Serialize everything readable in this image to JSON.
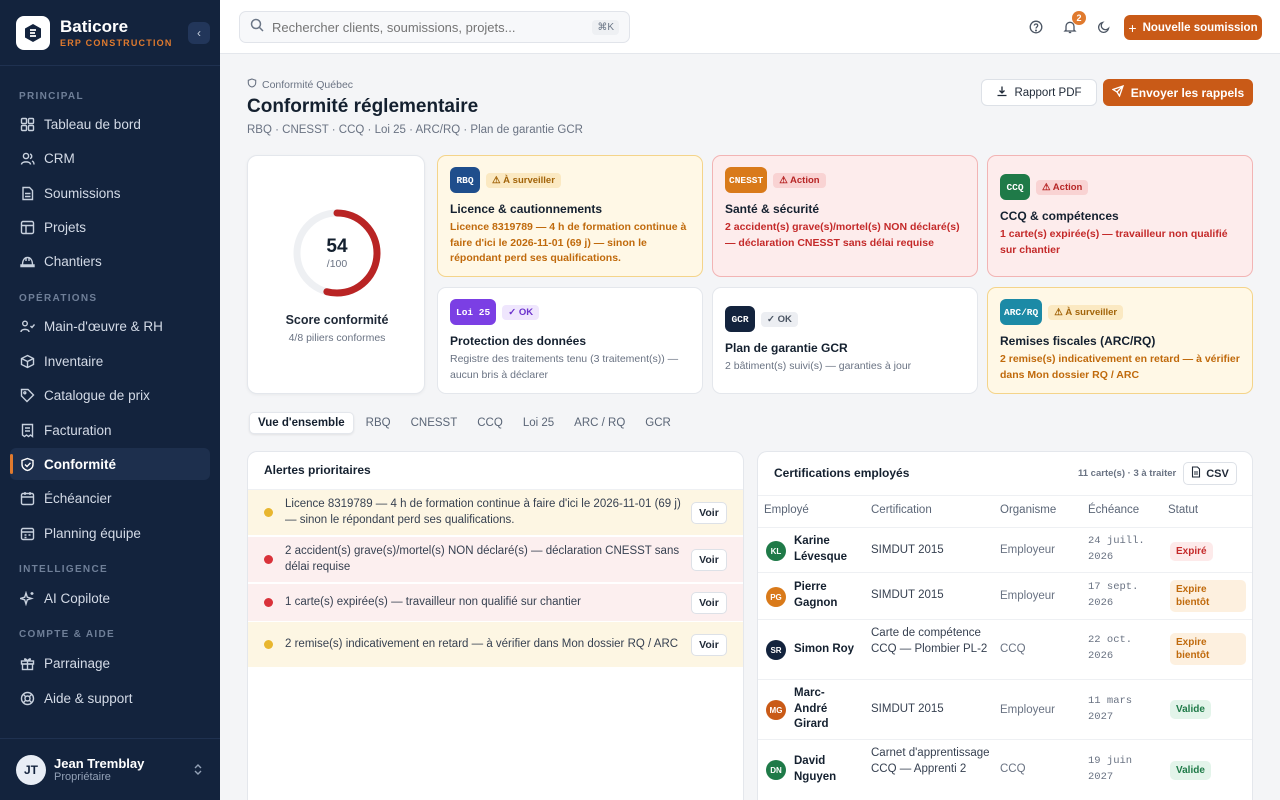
{
  "brand": {
    "name": "Baticore",
    "sub": "ERP CONSTRUCTION"
  },
  "sidebar": {
    "sections": [
      "PRINCIPAL",
      "OPÉRATIONS",
      "INTELLIGENCE",
      "COMPTE & AIDE"
    ],
    "items": [
      {
        "label": "Tableau de bord",
        "icon": "dashboard-icon"
      },
      {
        "label": "CRM",
        "icon": "users-icon"
      },
      {
        "label": "Soumissions",
        "icon": "document-icon"
      },
      {
        "label": "Projets",
        "icon": "folder-icon"
      },
      {
        "label": "Chantiers",
        "icon": "helmet-icon"
      },
      {
        "label": "Main-d'œuvre & RH",
        "icon": "team-icon"
      },
      {
        "label": "Inventaire",
        "icon": "box-icon"
      },
      {
        "label": "Catalogue de prix",
        "icon": "tag-icon"
      },
      {
        "label": "Facturation",
        "icon": "invoice-icon"
      },
      {
        "label": "Conformité",
        "icon": "shield-icon"
      },
      {
        "label": "Échéancier",
        "icon": "calendar-icon"
      },
      {
        "label": "Planning équipe",
        "icon": "planning-icon"
      },
      {
        "label": "AI Copilote",
        "icon": "sparkle-icon"
      },
      {
        "label": "Parrainage",
        "icon": "gift-icon"
      },
      {
        "label": "Aide & support",
        "icon": "help-icon"
      }
    ],
    "user": {
      "initials": "JT",
      "name": "Jean Tremblay",
      "role": "Propriétaire"
    }
  },
  "topbar": {
    "search_placeholder": "Rechercher clients, soumissions, projets...",
    "search_kbd": "⌘K",
    "notif_count": "2",
    "new_button": "Nouvelle soumission"
  },
  "header": {
    "breadcrumb": "Conformité Québec",
    "title": "Conformité réglementaire",
    "subtitle": "RBQ · CNESST · CCQ · Loi 25 · ARC/RQ · Plan de garantie GCR",
    "pdf_button": "Rapport PDF",
    "remind_button": "Envoyer les rappels"
  },
  "score": {
    "value": "54",
    "max": "/100",
    "percent": 54,
    "label": "Score conformité",
    "sub": "4/8 piliers conformes"
  },
  "pillars": [
    {
      "code": "RBQ",
      "tag": "⚠ À surveiller",
      "title": "Licence & cautionnements",
      "desc": "Licence 8319789 — 4 h de formation continue à faire d'ici le 2026-11-01 (69 j) — sinon le répondant perd ses qualifications.",
      "color": "#1f4e8c"
    },
    {
      "code": "CNESST",
      "tag": "⚠ Action",
      "title": "Santé & sécurité",
      "desc": "2 accident(s) grave(s)/mortel(s) NON déclaré(s) — déclaration CNESST sans délai requise",
      "color": "#d97a1a"
    },
    {
      "code": "CCQ",
      "tag": "⚠ Action",
      "title": "CCQ & compétences",
      "desc": "1 carte(s) expirée(s) — travailleur non qualifié sur chantier",
      "color": "#1f7a48"
    },
    {
      "code": "Loi 25",
      "tag": "✓ OK",
      "title": "Protection des données",
      "desc": "Registre des traitements tenu (3 traitement(s)) — aucun bris à déclarer",
      "color": "#7b3fe4"
    },
    {
      "code": "GCR",
      "tag": "✓ OK",
      "title": "Plan de garantie GCR",
      "desc": "2 bâtiment(s) suivi(s) — garanties à jour",
      "color": "#13233d"
    },
    {
      "code": "ARC/RQ",
      "tag": "⚠ À surveiller",
      "title": "Remises fiscales (ARC/RQ)",
      "desc": "2 remise(s) indicativement en retard — à vérifier dans Mon dossier RQ / ARC",
      "color": "#1c8aa6"
    }
  ],
  "tabs": [
    "Vue d'ensemble",
    "RBQ",
    "CNESST",
    "CCQ",
    "Loi 25",
    "ARC / RQ",
    "GCR"
  ],
  "alerts": {
    "title": "Alertes prioritaires",
    "action_label": "Voir",
    "items": [
      {
        "text": "Licence 8319789 — 4 h de formation continue à faire d'ici le 2026-11-01 (69 j) — sinon le répondant perd ses qualifications.",
        "level": "warn"
      },
      {
        "text": "2 accident(s) grave(s)/mortel(s) NON déclaré(s) — déclaration CNESST sans délai requise",
        "level": "alert"
      },
      {
        "text": "1 carte(s) expirée(s) — travailleur non qualifié sur chantier",
        "level": "alert"
      },
      {
        "text": "2 remise(s) indicativement en retard — à vérifier dans Mon dossier RQ / ARC",
        "level": "warn"
      }
    ]
  },
  "certs": {
    "title": "Certifications employés",
    "count": "11 carte(s) · 3 à traiter",
    "csv": "CSV",
    "columns": [
      "Employé",
      "Certification",
      "Organisme",
      "Échéance",
      "Statut"
    ],
    "rows": [
      {
        "initials": "KL",
        "name": "Karine Lévesque",
        "cert": "SIMDUT 2015",
        "org": "Employeur",
        "due": "24 juill. 2026",
        "status": "Expiré",
        "color": "#1f7a48"
      },
      {
        "initials": "PG",
        "name": "Pierre Gagnon",
        "cert": "SIMDUT 2015",
        "org": "Employeur",
        "due": "17 sept. 2026",
        "status": "Expire bientôt",
        "color": "#d97a1a"
      },
      {
        "initials": "SR",
        "name": "Simon Roy",
        "cert": "Carte de compétence CCQ — Plombier PL-2",
        "org": "CCQ",
        "due": "22 oct. 2026",
        "status": "Expire bientôt",
        "color": "#13233d"
      },
      {
        "initials": "MG",
        "name": "Marc-André Girard",
        "cert": "SIMDUT 2015",
        "org": "Employeur",
        "due": "11 mars 2027",
        "status": "Valide",
        "color": "#c95a17"
      },
      {
        "initials": "DN",
        "name": "David Nguyen",
        "cert": "Carnet d'apprentissage CCQ — Apprenti 2",
        "org": "CCQ",
        "due": "19 juin 2027",
        "status": "Valide",
        "color": "#1f7a48"
      }
    ]
  }
}
